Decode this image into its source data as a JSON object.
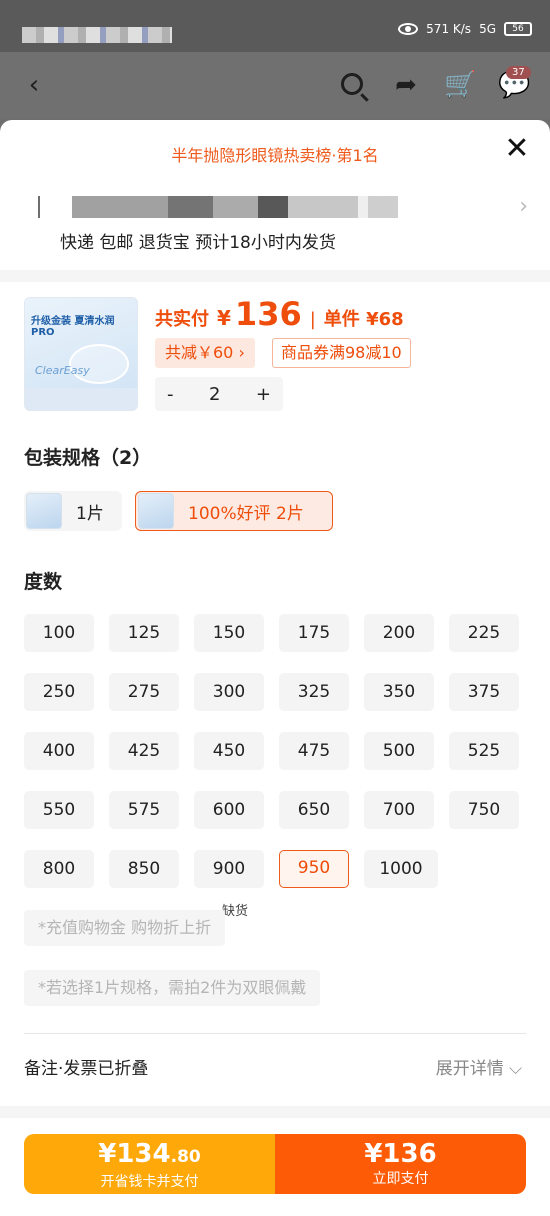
{
  "status_bar": {
    "net_speed": "571 K/s",
    "network": "5G",
    "battery": "56"
  },
  "nav": {
    "back_icon": "back-chevron-icon",
    "search_icon": "search-icon",
    "share_icon": "share-icon",
    "cart_icon": "cart-icon",
    "message_icon": "message-icon",
    "message_badge": "37"
  },
  "sheet": {
    "rank_title": "半年抛隐形眼镜热卖榜·第1名",
    "close_label": "✕",
    "shipping": "快递 包邮 退货宝 预计18小时内发货"
  },
  "product": {
    "thumb_line1": "升级金装 夏清水润PRO",
    "thumb_brand": "ClearEasy",
    "total_label": "共实付",
    "currency": "¥",
    "total_price": "136",
    "unit_label": "单件 ¥68",
    "discount": "共减￥60 ›",
    "coupon": "商品券满98减10",
    "qty_minus": "-",
    "quantity": "2",
    "qty_plus": "+"
  },
  "spec": {
    "title": "包装规格（2）",
    "options": [
      {
        "label": "1片"
      },
      {
        "label": "100%好评  2片"
      }
    ]
  },
  "power": {
    "title": "度数",
    "values": [
      "100",
      "125",
      "150",
      "175",
      "200",
      "225",
      "250",
      "275",
      "300",
      "325",
      "350",
      "375",
      "400",
      "425",
      "450",
      "475",
      "500",
      "525",
      "550",
      "575",
      "600",
      "650",
      "700",
      "750",
      "800",
      "850",
      "900",
      "950",
      "1000"
    ],
    "selected": "950",
    "out_of_stock": "缺货"
  },
  "notes": {
    "note1": "*充值购物金 购物折上折",
    "note2": "*若选择1片规格，需拍2件为双眼佩戴"
  },
  "remark": {
    "label": "备注·发票已折叠",
    "expand": "展开详情 ⌵"
  },
  "pay": {
    "left_amount_int": "¥134",
    "left_amount_dec": ".80",
    "left_label": "开省钱卡并支付",
    "right_amount": "¥136",
    "right_label": "立即支付"
  }
}
